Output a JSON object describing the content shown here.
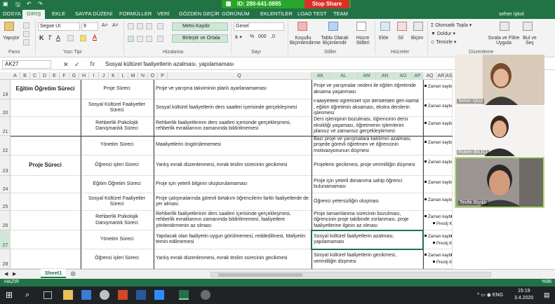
{
  "titlebar": {
    "file_tab": "DOSYA",
    "zoom_id": "ID: 280-641-0895",
    "stop_share": "Stop Share"
  },
  "tabs": [
    "DOSYA",
    "GİRİŞ",
    "EKLE",
    "SAYFA DÜZENİ",
    "FORMÜLLER",
    "VERİ",
    "GÖZDEN GEÇİR",
    "GÖRÜNÜM",
    "EKLENTİLER",
    "LOAD TEST",
    "TEAM"
  ],
  "active_tab": "GİRİŞ",
  "user": "seher işkol",
  "ribbon": {
    "paste": "Yapıştır",
    "font_name": "Segoe UI",
    "font_size": "9",
    "wrap_text": "Metni Kaydır",
    "merge_center": "Birleştir ve Ortala",
    "number_format": "Genel",
    "cond_format": "Koşullu Biçimlendirme",
    "table_format": "Tablo Olarak Biçimlendir",
    "cell_styles": "Hücre Stilleri",
    "insert": "Ekle",
    "delete": "Sil",
    "format": "Biçim",
    "autosum": "Otomatik Topla",
    "fill": "Doldur",
    "clear": "Temizle",
    "sort_filter": "Sırala ve Filtre Uygula",
    "find_select": "Bul ve Seç",
    "groups": {
      "clipboard": "Pano",
      "font": "Yazı Tipi",
      "alignment": "Hizalama",
      "number": "Sayı",
      "styles": "Stiller",
      "cells": "Hücreler",
      "editing": "Düzenleme"
    }
  },
  "formula_bar": {
    "name_box": "AK27",
    "fx": "fx",
    "content": "Sosyal kültürel faaliyetlerin azalması, yapılamaması"
  },
  "columns": [
    {
      "label": "A",
      "sel": false
    },
    {
      "label": "B",
      "sel": false
    },
    {
      "label": "C",
      "sel": false
    },
    {
      "label": "D",
      "sel": false
    },
    {
      "label": "E",
      "sel": false
    },
    {
      "label": "F",
      "sel": false
    },
    {
      "label": "G",
      "sel": false
    },
    {
      "label": "H",
      "sel": false
    },
    {
      "label": "I",
      "sel": false
    },
    {
      "label": "J",
      "sel": false
    },
    {
      "label": "K",
      "sel": false
    },
    {
      "label": "L",
      "sel": false
    },
    {
      "label": "M",
      "sel": false
    },
    {
      "label": "N",
      "sel": false
    },
    {
      "label": "O",
      "sel": false
    },
    {
      "label": "P",
      "sel": false
    },
    {
      "label": "Q",
      "sel": false
    },
    {
      "label": "AK",
      "sel": true
    },
    {
      "label": "AL",
      "sel": true
    },
    {
      "label": "AM",
      "sel": true
    },
    {
      "label": "AN",
      "sel": true
    },
    {
      "label": "AO",
      "sel": true
    },
    {
      "label": "AP",
      "sel": true
    },
    {
      "label": "AQ",
      "sel": false
    },
    {
      "label": "AR",
      "sel": false
    },
    {
      "label": "AS",
      "sel": false
    }
  ],
  "rows": [
    {
      "num": "19",
      "sel": false,
      "group": "Eğitim Öğretim Süreci",
      "unit": "Proje Süreci",
      "risk": "Proje ve yarışma takviminin planlı ayarlanamaması",
      "cause": "Proje ve yarışmalar nedeni ile eğitim öğretimde aksama yaşanması",
      "legend": [
        "Zaman kaybı"
      ]
    },
    {
      "num": "20",
      "sel": false,
      "group": "",
      "unit": "Sosyal Kültürel Faaliyetler Süreci",
      "risk": "Sosyal kültürel faaliyetlerin ders saatleri içerisinde gerçekleşmesi",
      "cause": "Faaliyetteki öğrenciler için derslerden geri kalma , eğitim öğretimin aksaması, ekstra derslerin işlenmesi",
      "legend": [
        "Zaman kaybı"
      ]
    },
    {
      "num": "21",
      "sel": false,
      "group": "",
      "unit": "Rehberlik Psikolojik Danışmanlık Süreci",
      "risk": "Rehberlik faaliyetlerinin ders saatleri içerisinde gerçekleşmesi, rehberlik evraklarının zamanında bildirilmemesi",
      "cause": "Ders işlenişinin bozulması, öğrencinin dersi eksikliği yaşaması, öğretmenin işlemlerini plansız ve zamansız gerçekleştirmesi",
      "legend": [
        "Zaman kaybı"
      ]
    },
    {
      "num": "22",
      "sel": false,
      "group": "",
      "unit": "Yönetim Süreci",
      "risk": "Maaliyetlerin öngörülememesi",
      "cause": "Bazı proje ve yarışmalara katılımın azalması, projede görevli öğretmen ve öğrencinin motivasyonunun düşmesi",
      "legend": [
        "Zaman kaybı"
      ]
    },
    {
      "num": "23",
      "sel": false,
      "group": "Proje Süreci",
      "unit": "Öğrenci işleri Süreci",
      "risk": "Yanlış evrak düzenlenmesi, evrak teslim sürecinin gecikmesi",
      "cause": "Projelerin gecikmesi, proje verimliliğin düşmesi",
      "legend": [
        "Zaman kaybı"
      ]
    },
    {
      "num": "24",
      "sel": false,
      "group": "",
      "unit": "Eğitim Öğretim Süreci",
      "risk": "Proje için yeterli bilginin oluşturulamaması",
      "cause": "Proje için yeterli donanıma sahip öğrenci bulunamaması",
      "legend": [
        "Zaman kaybı"
      ]
    },
    {
      "num": "25",
      "sel": false,
      "group": "",
      "unit": "Sosyal Kültürel Faaliyetler Süreci",
      "risk": "Proje çalışmalarında görevli birtakım öğrencilerin farklı faaliyetlerde de yer alması",
      "cause": "Öğrenci yetersizliğin oluşması",
      "legend": [
        "Zaman kaybı"
      ]
    },
    {
      "num": "26",
      "sel": false,
      "group": "",
      "unit": "Rehberlik Psikolojik Danışmanlık Süreci",
      "risk": "Rehberlik faaliyetlerinin ders saatleri içerisinde gerçekleşmesi, rehberlik evraklarının zamanında bildirilmemesi, faaliyetlere yönlendirmenin az olması",
      "cause": "Proje tamamlanma sürecinin bozulması, öğrencinin proje takibinde zorlanması, proje faaliyetlerine ilginin az olması",
      "legend": [
        "Zaman kaybı",
        "İşgücü Kaybı",
        "Prestij Kaybı"
      ]
    },
    {
      "num": "27",
      "sel": true,
      "group": "",
      "unit": "Yönetim Süreci",
      "risk": "Yapılacak olan faaliyetin uygun görülmemesi, reddedilmesi, Maliyetin temin edilmemesi",
      "cause": "Sosyal kültürel faaliyetlerin azalması, yapılamaması",
      "legend": [
        "Zaman kaybı",
        "İşgücü Kaybı",
        "Prestij Kaybı"
      ]
    },
    {
      "num": "28",
      "sel": false,
      "group": "",
      "unit": "Öğrenci işleri Süreci",
      "risk": "Yanlış evrak düzenlenmesi, evrak teslim sürecinin gecikmesi",
      "cause": "Sosyal kültürel faaliyetlerin gecikmesi, verimliliğin düşmesi",
      "legend": [
        "Zaman kaybı",
        "İşgücü Kaybı",
        "Prestij Kaybı"
      ]
    }
  ],
  "participants": [
    {
      "name": "Seher İşkol"
    },
    {
      "name": "Ruken BILICI"
    },
    {
      "name": "Tevfik Biyıklı"
    }
  ],
  "sheet_tab": "Sheet1",
  "status": {
    "ready": "HAZIR",
    "zoom": "%96"
  },
  "taskbar": {
    "time": "15:19",
    "date": "3.4.2020"
  },
  "colors": {
    "excel_green": "#217346",
    "zoom_green": "#2aa52a",
    "stop_red": "#d93025"
  }
}
